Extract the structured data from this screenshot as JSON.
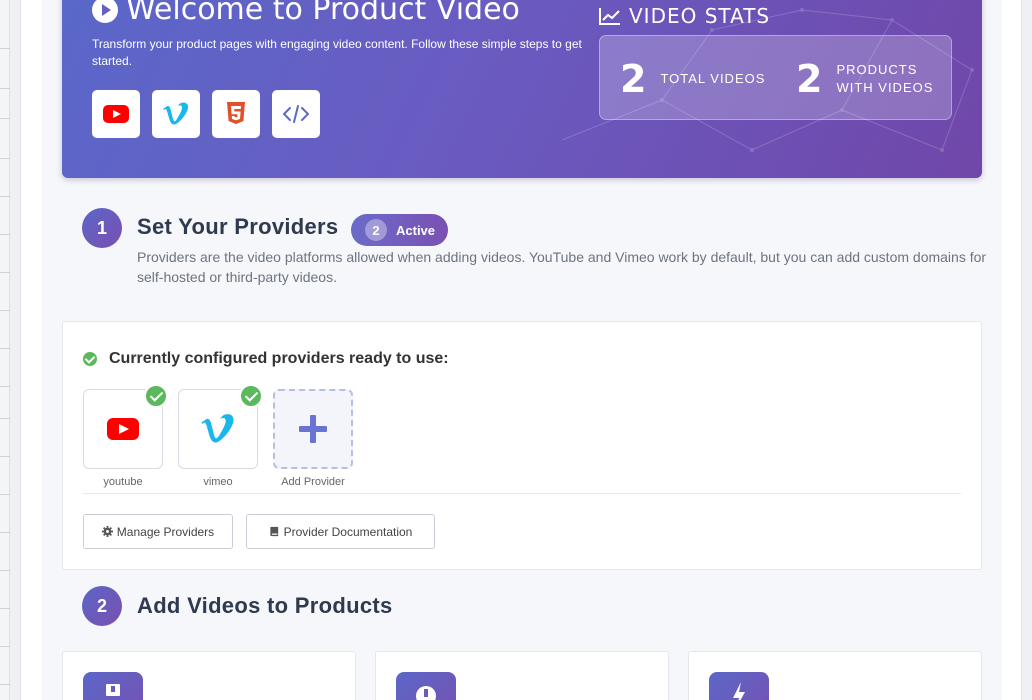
{
  "hero": {
    "title": "Welcome to Product Video",
    "subtitle": "Transform your product pages with engaging video content. Follow these simple steps to get started.",
    "provider_icons": [
      "youtube-icon",
      "vimeo-icon",
      "html5-icon",
      "code-icon"
    ]
  },
  "stats": {
    "title": "VIDEO STATS",
    "items": [
      {
        "value": "2",
        "label_line1": "TOTAL VIDEOS",
        "label_line2": ""
      },
      {
        "value": "2",
        "label_line1": "PRODUCTS",
        "label_line2": "WITH VIDEOS"
      }
    ]
  },
  "step1": {
    "number": "1",
    "title": "Set Your Providers",
    "badge_count": "2",
    "badge_label": "Active",
    "description": "Providers are the video platforms allowed when adding videos. YouTube and Vimeo work by default, but you can add custom domains for self-hosted or third-party videos."
  },
  "providers_card": {
    "heading": "Currently configured providers ready to use:",
    "providers": [
      {
        "name": "youtube",
        "configured": true
      },
      {
        "name": "vimeo",
        "configured": true
      },
      {
        "name": "Add Provider",
        "configured": false
      }
    ],
    "manage_label": "Manage Providers",
    "docs_label": "Provider Documentation"
  },
  "step2": {
    "number": "2",
    "title": "Add Videos to Products"
  },
  "colors": {
    "accent_start": "#5a68c9",
    "accent_end": "#7047a9",
    "success": "#5cb85c",
    "youtube_red": "#ff0000",
    "vimeo_blue": "#1ab7ea",
    "html5_orange": "#e34f26"
  }
}
